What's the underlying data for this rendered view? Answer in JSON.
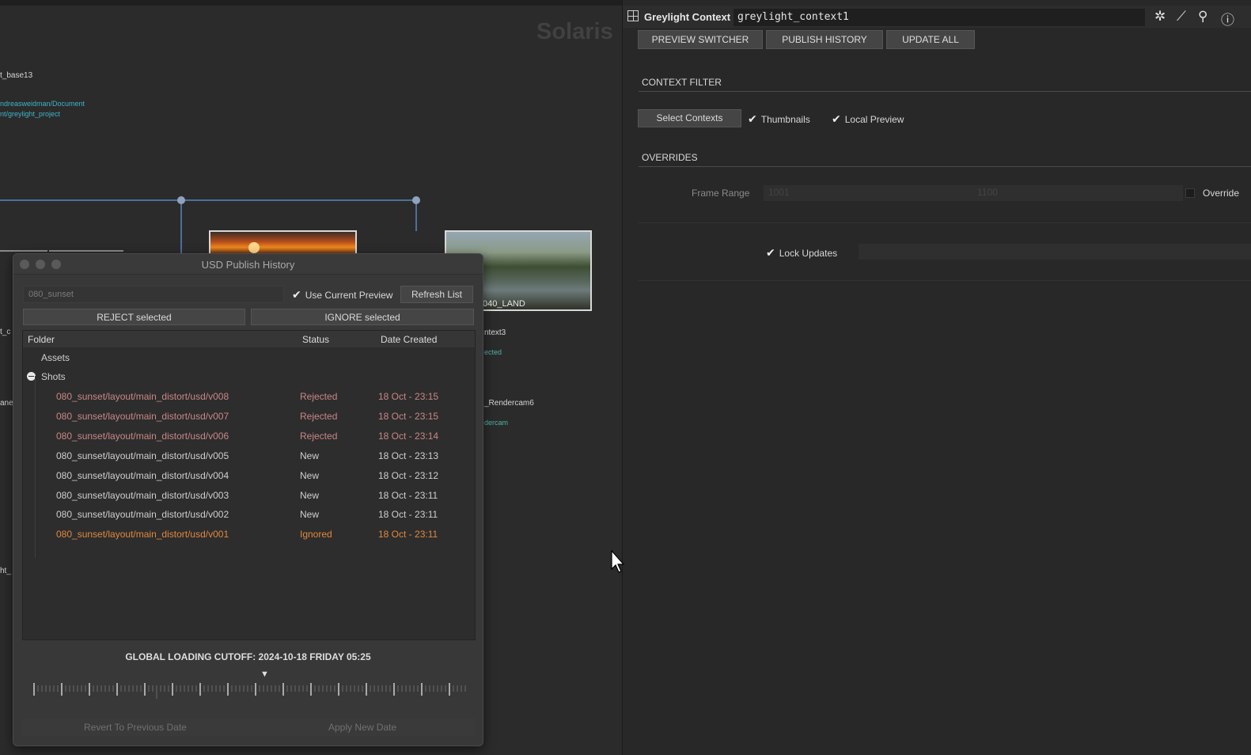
{
  "network": {
    "watermark": "Solaris",
    "labels": {
      "node_base": "t_base13",
      "path1": "ndreasweidman/Document",
      "path2": "nt/greylight_project",
      "thumb_land": "040_LAND",
      "ctx3": "ntext3",
      "ctx3_sub": "ected",
      "rendercam": "_Rendercam6",
      "rendercam_sub": "dercam",
      "left_a": "t_c",
      "left_b": "ane",
      "left_c": "ht_"
    }
  },
  "publish_window": {
    "title": "USD Publish History",
    "context_value": "080_sunset",
    "use_current_preview": "Use Current Preview",
    "refresh": "Refresh List",
    "reject": "REJECT selected",
    "ignore": "IGNORE selected",
    "columns": {
      "folder": "Folder",
      "status": "Status",
      "date": "Date Created"
    },
    "groups": {
      "assets": "Assets",
      "shots": "Shots"
    },
    "rows": [
      {
        "path": "080_sunset/layout/main_distort/usd/v008",
        "status": "Rejected",
        "date": "18 Oct - 23:15",
        "kind": "rej"
      },
      {
        "path": "080_sunset/layout/main_distort/usd/v007",
        "status": "Rejected",
        "date": "18 Oct - 23:15",
        "kind": "rej"
      },
      {
        "path": "080_sunset/layout/main_distort/usd/v006",
        "status": "Rejected",
        "date": "18 Oct - 23:14",
        "kind": "rej"
      },
      {
        "path": "080_sunset/layout/main_distort/usd/v005",
        "status": "New",
        "date": "18 Oct - 23:13",
        "kind": "new"
      },
      {
        "path": "080_sunset/layout/main_distort/usd/v004",
        "status": "New",
        "date": "18 Oct - 23:12",
        "kind": "new"
      },
      {
        "path": "080_sunset/layout/main_distort/usd/v003",
        "status": "New",
        "date": "18 Oct - 23:11",
        "kind": "new"
      },
      {
        "path": "080_sunset/layout/main_distort/usd/v002",
        "status": "New",
        "date": "18 Oct - 23:11",
        "kind": "new"
      },
      {
        "path": "080_sunset/layout/main_distort/usd/v001",
        "status": "Ignored",
        "date": "18 Oct - 23:11",
        "kind": "ign"
      }
    ],
    "cutoff": "GLOBAL LOADING CUTOFF: 2024-10-18 FRIDAY 05:25",
    "revert": "Revert To Previous Date",
    "apply": "Apply New Date"
  },
  "panel": {
    "node_type": "Greylight Context",
    "node_name": "greylight_context1",
    "tabs": [
      "PREVIEW SWITCHER",
      "PUBLISH HISTORY",
      "UPDATE ALL"
    ],
    "context_filter": "CONTEXT FILTER",
    "select_contexts": "Select Contexts",
    "thumbnails": "Thumbnails",
    "local_preview": "Local Preview",
    "overrides": "OVERRIDES",
    "frame_range": "Frame Range",
    "frame_start": "1001",
    "frame_end": "1100",
    "override": "Override",
    "lock_updates": "Lock Updates",
    "icons": [
      "gear-icon",
      "brush-icon",
      "search-icon",
      "info-icon"
    ]
  },
  "colors": {
    "rejected": "#c98686",
    "ignored": "#e0883e",
    "wire": "#4d6f9c",
    "background": "#282828"
  }
}
